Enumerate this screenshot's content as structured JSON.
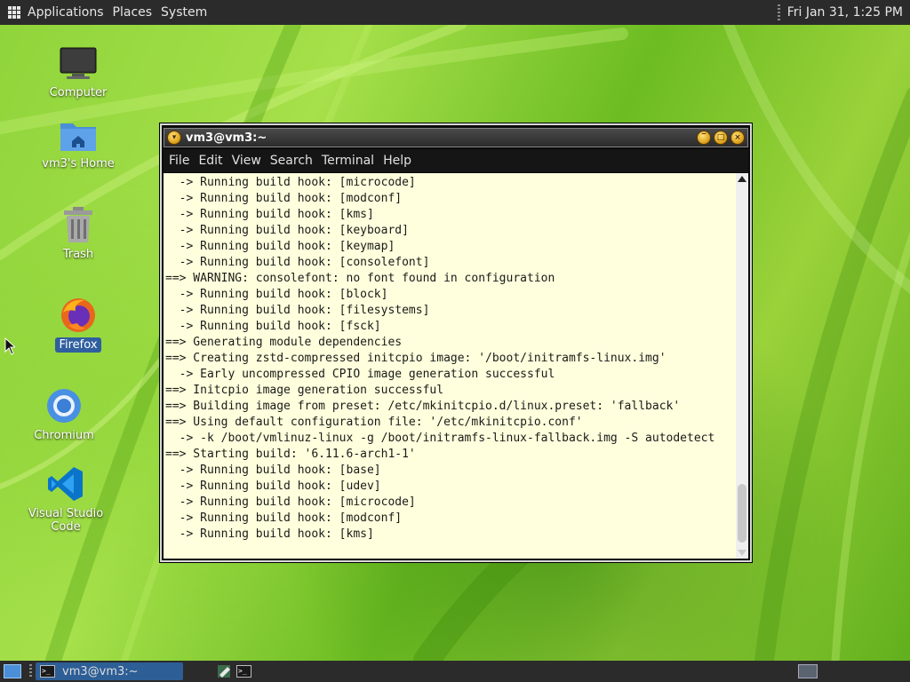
{
  "top_panel": {
    "menus": [
      "Applications",
      "Places",
      "System"
    ],
    "clock": "Fri Jan 31, 1:25 PM"
  },
  "desktop_icons": [
    {
      "label": "Computer",
      "icon": "computer-icon"
    },
    {
      "label": "vm3's Home",
      "icon": "home-folder-icon"
    },
    {
      "label": "Trash",
      "icon": "trash-icon"
    },
    {
      "label": "Firefox",
      "icon": "firefox-icon",
      "selected": true
    },
    {
      "label": "Chromium",
      "icon": "chromium-icon"
    },
    {
      "label": "Visual Studio Code",
      "icon": "vscode-icon"
    }
  ],
  "terminal": {
    "title": "vm3@vm3:~",
    "menu": [
      "File",
      "Edit",
      "View",
      "Search",
      "Terminal",
      "Help"
    ],
    "lines": [
      "  -> Running build hook: [microcode]",
      "  -> Running build hook: [modconf]",
      "  -> Running build hook: [kms]",
      "  -> Running build hook: [keyboard]",
      "  -> Running build hook: [keymap]",
      "  -> Running build hook: [consolefont]",
      "==> WARNING: consolefont: no font found in configuration",
      "  -> Running build hook: [block]",
      "  -> Running build hook: [filesystems]",
      "  -> Running build hook: [fsck]",
      "==> Generating module dependencies",
      "==> Creating zstd-compressed initcpio image: '/boot/initramfs-linux.img'",
      "  -> Early uncompressed CPIO image generation successful",
      "==> Initcpio image generation successful",
      "==> Building image from preset: /etc/mkinitcpio.d/linux.preset: 'fallback'",
      "==> Using default configuration file: '/etc/mkinitcpio.conf'",
      "  -> -k /boot/vmlinuz-linux -g /boot/initramfs-linux-fallback.img -S autodetect",
      "==> Starting build: '6.11.6-arch1-1'",
      "  -> Running build hook: [base]",
      "  -> Running build hook: [udev]",
      "  -> Running build hook: [microcode]",
      "  -> Running build hook: [modconf]",
      "  -> Running build hook: [kms]"
    ]
  },
  "taskbar": {
    "window_button": "vm3@vm3:~"
  },
  "colors": {
    "terminal_bg": "#ffffdd",
    "panel_bg": "#2b2b2b",
    "task_active": "#2d5e96"
  }
}
